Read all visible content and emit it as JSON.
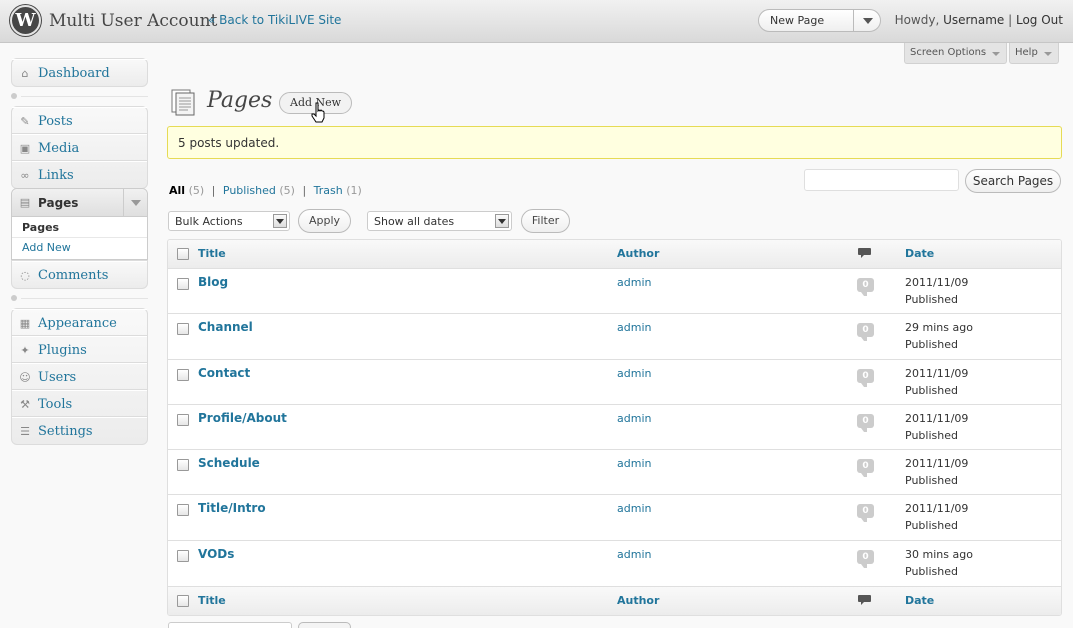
{
  "header": {
    "site_title": "Multi User Account",
    "back_link": "« Back to TikiLIVE Site",
    "favorite_action": "New Page",
    "howdy": "Howdy,",
    "username": "Username",
    "separator": "|",
    "logout": "Log Out"
  },
  "screen_meta": {
    "screen_options": "Screen Options",
    "help": "Help"
  },
  "sidebar": {
    "group1": [
      {
        "label": "Dashboard",
        "icon": "dashboard-icon"
      }
    ],
    "group2": [
      {
        "label": "Posts",
        "icon": "pin-icon"
      },
      {
        "label": "Media",
        "icon": "media-icon"
      },
      {
        "label": "Links",
        "icon": "link-icon"
      }
    ],
    "pages": {
      "label": "Pages",
      "icon": "pages-icon",
      "submenu": [
        "Pages",
        "Add New"
      ]
    },
    "comments": {
      "label": "Comments",
      "icon": "comment-icon"
    },
    "group3": [
      {
        "label": "Appearance",
        "icon": "appearance-icon"
      },
      {
        "label": "Plugins",
        "icon": "plugin-icon"
      },
      {
        "label": "Users",
        "icon": "users-icon"
      },
      {
        "label": "Tools",
        "icon": "tools-icon"
      },
      {
        "label": "Settings",
        "icon": "settings-icon"
      }
    ]
  },
  "main": {
    "title": "Pages",
    "add_new": "Add New",
    "notice": "5 posts updated.",
    "filters": {
      "all": "All",
      "all_count": "(5)",
      "published": "Published",
      "published_count": "(5)",
      "trash": "Trash",
      "trash_count": "(1)"
    },
    "search_button": "Search Pages",
    "bulk_actions": "Bulk Actions",
    "apply": "Apply",
    "dates": "Show all dates",
    "filter": "Filter"
  },
  "table": {
    "columns": {
      "title": "Title",
      "author": "Author",
      "date": "Date"
    },
    "rows": [
      {
        "title": "Blog",
        "author": "admin",
        "comments": "0",
        "date": "2011/11/09",
        "status": "Published"
      },
      {
        "title": "Channel",
        "author": "admin",
        "comments": "0",
        "date": "29 mins ago",
        "status": "Published"
      },
      {
        "title": "Contact",
        "author": "admin",
        "comments": "0",
        "date": "2011/11/09",
        "status": "Published"
      },
      {
        "title": "Profile/About",
        "author": "admin",
        "comments": "0",
        "date": "2011/11/09",
        "status": "Published"
      },
      {
        "title": "Schedule",
        "author": "admin",
        "comments": "0",
        "date": "2011/11/09",
        "status": "Published"
      },
      {
        "title": "Title/Intro",
        "author": "admin",
        "comments": "0",
        "date": "2011/11/09",
        "status": "Published"
      },
      {
        "title": "VODs",
        "author": "admin",
        "comments": "0",
        "date": "30 mins ago",
        "status": "Published"
      }
    ]
  }
}
